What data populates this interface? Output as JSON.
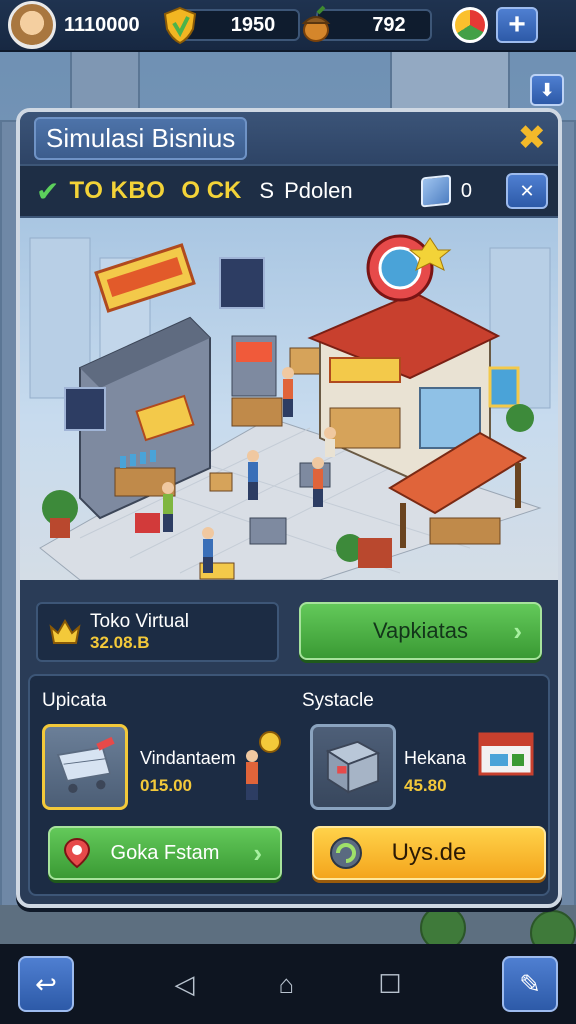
{
  "top_bar": {
    "coins": "1110000",
    "gems": "1950",
    "food": "792"
  },
  "panel": {
    "title": "Simulasi Bisnius",
    "close_icon": "close-icon",
    "status_bar": {
      "status_a": "TO KBO",
      "status_b": "O CK",
      "s_label": "S",
      "name": "Pdolen",
      "count": "0"
    }
  },
  "shop": {
    "name": "Toko Virtual",
    "value": "32.08.B"
  },
  "actions": {
    "primary_label": "Vapkiatas",
    "green_label": "Goka Fstam",
    "orange_label": "Uys.de"
  },
  "sections": {
    "left_title": "Upicata",
    "right_title": "Systacle",
    "left_item": {
      "name": "Vindantaem",
      "price": "015.00"
    },
    "right_item": {
      "name": "Hekana",
      "price": "45.80"
    }
  },
  "colors": {
    "accent_yellow": "#f3c93a",
    "green": "#3a9a34",
    "orange": "#f4a51c",
    "panel": "#2a3c57"
  }
}
